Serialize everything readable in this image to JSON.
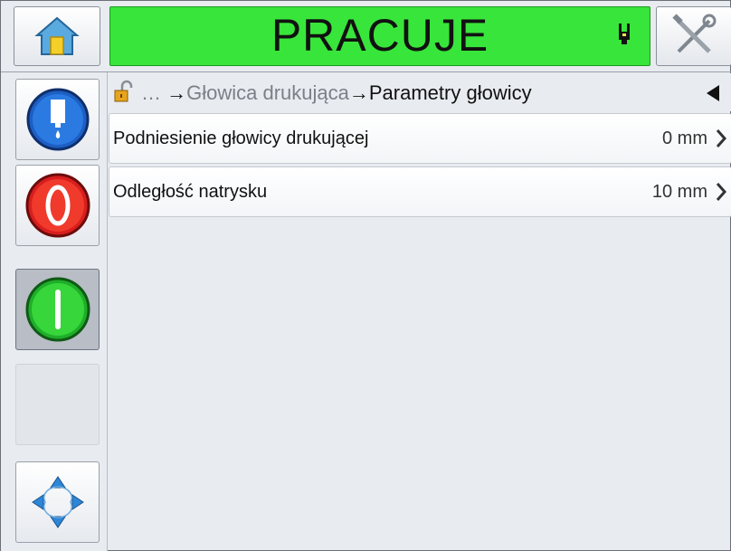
{
  "header": {
    "status": "PRACUJE",
    "status_color": "#38e53a",
    "home_icon": "home-icon",
    "printhead_icon": "printhead-icon",
    "tools_icon": "tools-icon"
  },
  "sidebar": {
    "items": [
      {
        "name": "ink-icon"
      },
      {
        "name": "stop-icon"
      },
      {
        "name": "start-icon",
        "active": true
      },
      {
        "name": "empty"
      },
      {
        "name": "navigation-icon"
      }
    ]
  },
  "breadcrumb": {
    "lock_icon": "unlock-icon",
    "ellipsis": "…",
    "arrow1": "→",
    "parent": "Głowica drukująca",
    "arrow2": "→",
    "current": "Parametry głowicy",
    "back_icon": "back-arrow-icon"
  },
  "rows": [
    {
      "label": "Podniesienie głowicy drukującej",
      "value": "0 mm"
    },
    {
      "label": "Odległość natrysku",
      "value": "10 mm"
    }
  ]
}
